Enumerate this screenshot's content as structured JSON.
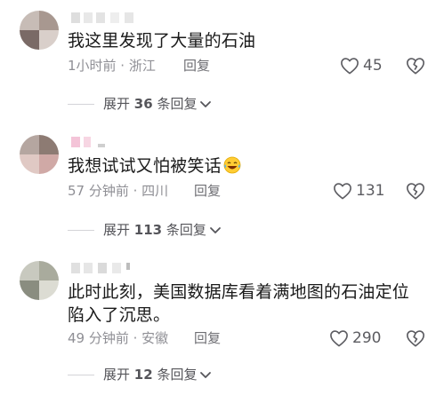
{
  "comments": [
    {
      "text": "我这里发现了大量的石油",
      "time": "1小时前 · 浙江",
      "reply_label": "回复",
      "likes": "45",
      "expand_prefix": "展开",
      "expand_count": "36",
      "expand_suffix": "条回复"
    },
    {
      "text": "我想试试又怕被笑话",
      "emoji": "laughing-tears-emoji",
      "time": "57 分钟前 · 四川",
      "reply_label": "回复",
      "likes": "131",
      "expand_prefix": "展开",
      "expand_count": "113",
      "expand_suffix": "条回复"
    },
    {
      "text": "此时此刻，美国数据库看着满地图的石油定位\n陷入了沉思。",
      "time": "49 分钟前 · 安徽",
      "reply_label": "回复",
      "likes": "290",
      "expand_prefix": "展开",
      "expand_count": "12",
      "expand_suffix": "条回复"
    }
  ],
  "icons": {
    "like": "heart-outline-icon",
    "dislike": "broken-heart-icon",
    "expand": "chevron-down-icon"
  },
  "colors": {
    "text": "#1a1a1a",
    "meta": "#8f8f95",
    "icon": "#5c5c61",
    "divider": "#d4d4d8"
  }
}
